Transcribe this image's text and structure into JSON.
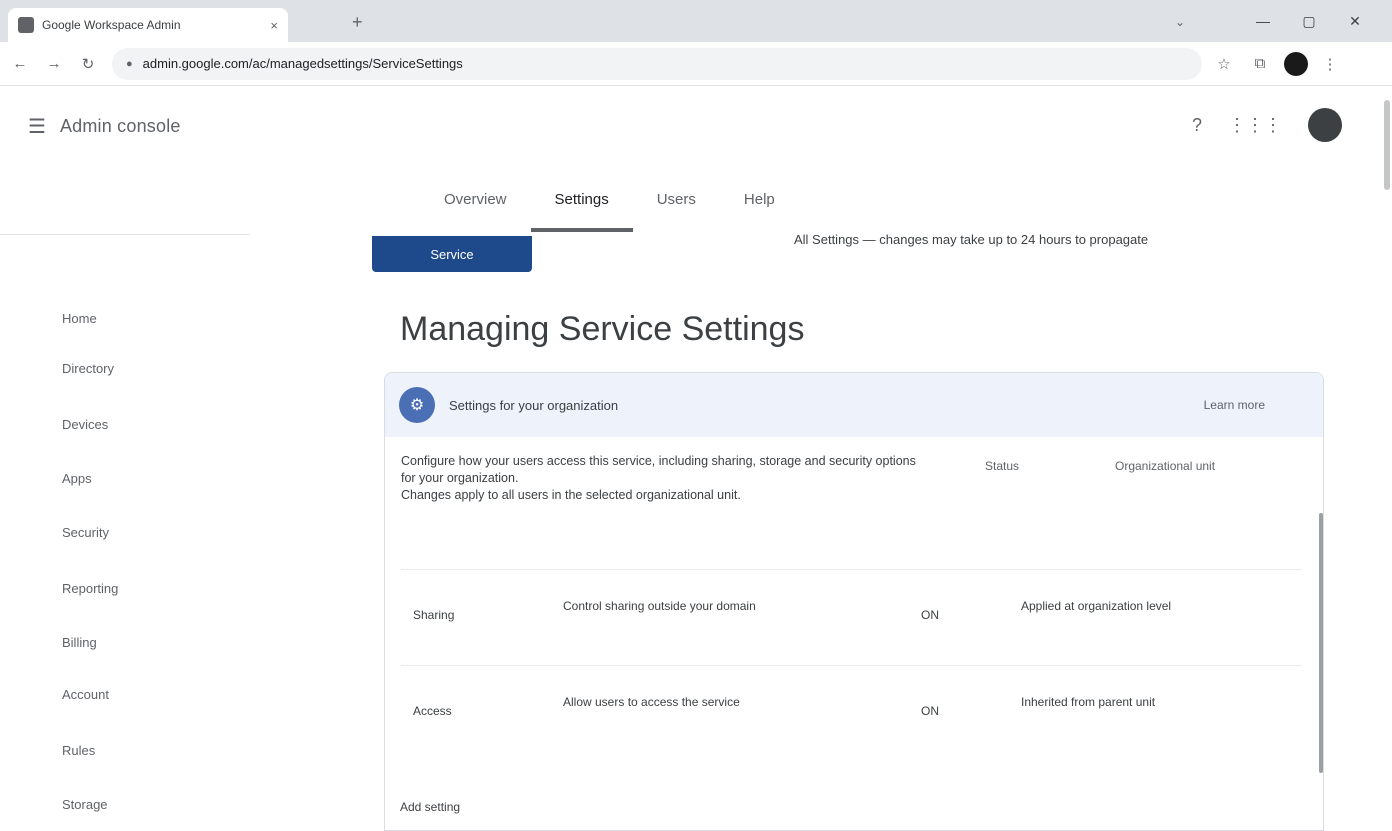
{
  "browser": {
    "tab_title": "Google Workspace Admin",
    "tab_close": "×",
    "new_tab": "+",
    "tab_search": "⌄",
    "window_controls": [
      "—",
      "▢",
      "✕"
    ],
    "url": "admin.google.com/ac/managedsettings/ServiceSettings",
    "nav": [
      "←",
      "→",
      "↻"
    ],
    "toolbar_icons": [
      "☆",
      "⧉",
      "⋮"
    ]
  },
  "site": {
    "logo": "Admin console",
    "header_icons": [
      "?",
      "⋮⋮⋮"
    ]
  },
  "tabs": [
    "Overview",
    "Settings",
    "Users",
    "Help"
  ],
  "sidebar": {
    "items": [
      "Home",
      "Directory",
      "Devices",
      "Apps",
      "Security",
      "Reporting",
      "Billing",
      "Account",
      "Rules",
      "Storage"
    ]
  },
  "main": {
    "section_tag": "Service",
    "top_note": "All Settings — changes may take up to 24 hours to propagate",
    "title": "Managing Service Settings",
    "card": {
      "title": "Settings for your organization",
      "header_link": "Learn more",
      "description_1": "Configure how your users access this service, including sharing, storage and security options for your organization.",
      "description_2": "Changes apply to all users in the selected organizational unit.",
      "columns": [
        "Status",
        "Organizational unit"
      ],
      "rows": [
        {
          "name": "Sharing",
          "detail": "Control sharing outside your domain",
          "status": "ON",
          "scope": "Applied at organization level"
        },
        {
          "name": "Access",
          "detail": "Allow users to access the service",
          "status": "ON",
          "scope": "Inherited from parent unit"
        }
      ]
    },
    "footer_note": "Add setting"
  }
}
